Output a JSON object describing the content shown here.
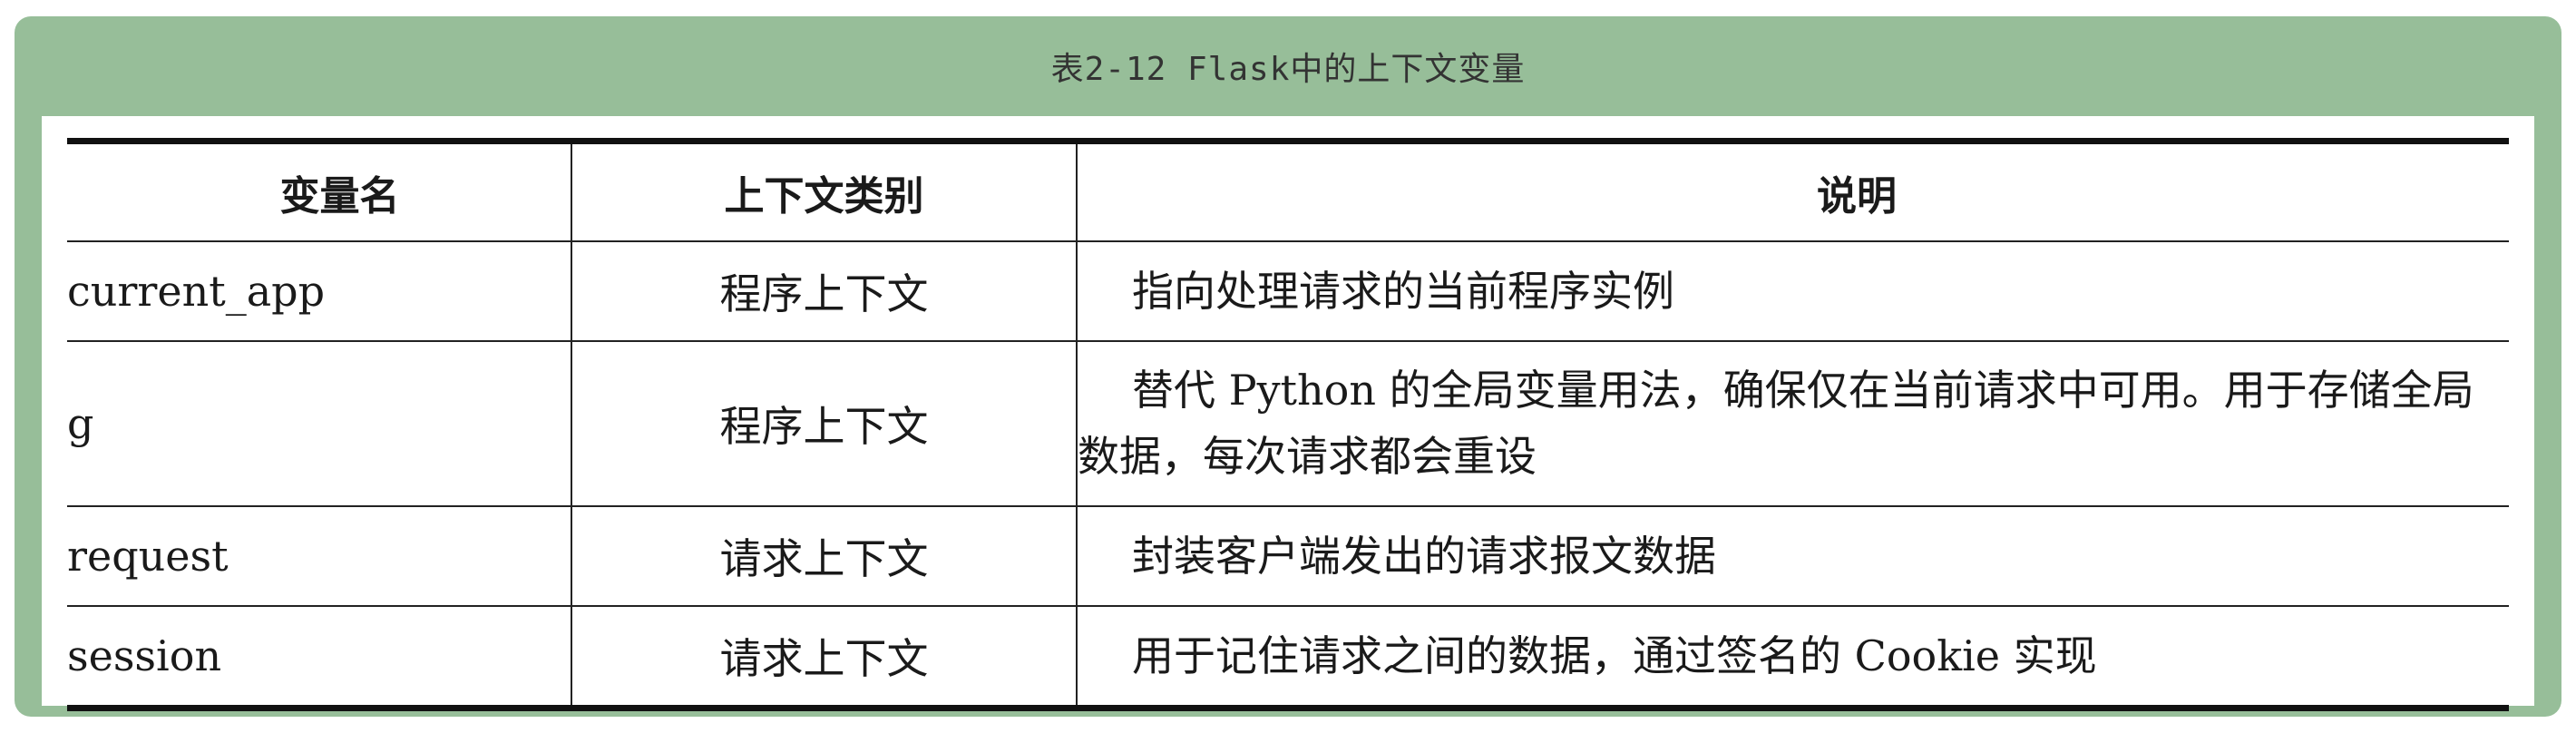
{
  "caption": "表2-12  Flask中的上下文变量",
  "table": {
    "headers": [
      "变量名",
      "上下文类别",
      "说明"
    ],
    "rows": [
      {
        "name": "current_app",
        "category": "程序上下文",
        "description": "指向处理请求的当前程序实例"
      },
      {
        "name": "g",
        "category": "程序上下文",
        "description": "替代 Python 的全局变量用法，确保仅在当前请求中可用。用于存储全局数据，每次请求都会重设"
      },
      {
        "name": "request",
        "category": "请求上下文",
        "description": "封装客户端发出的请求报文数据"
      },
      {
        "name": "session",
        "category": "请求上下文",
        "description": "用于记住请求之间的数据，通过签名的 Cookie 实现"
      }
    ]
  },
  "colors": {
    "frame_green": "#97be99",
    "rule": "#111111"
  }
}
